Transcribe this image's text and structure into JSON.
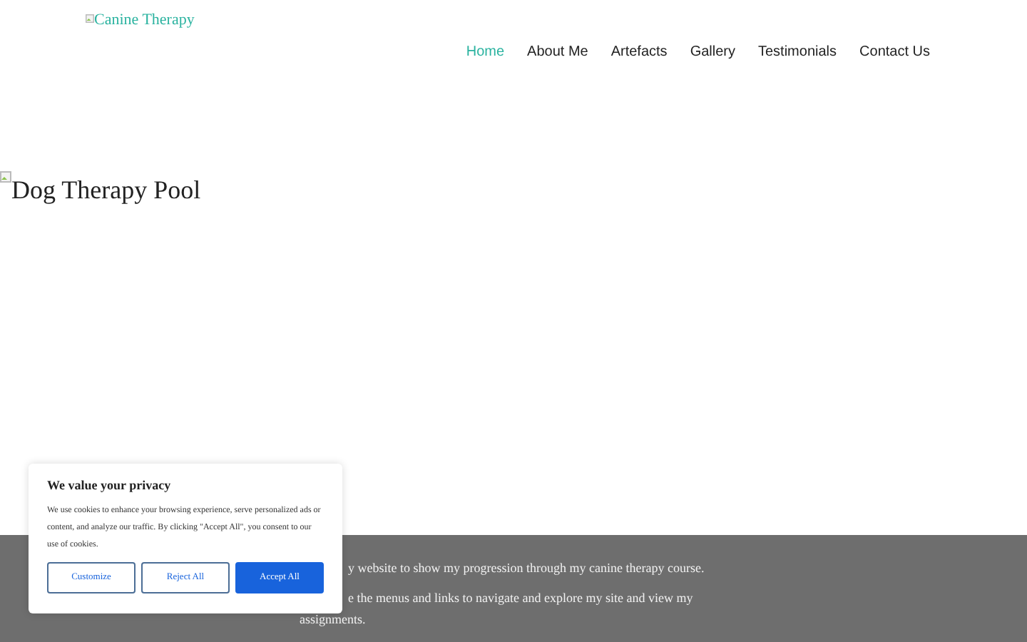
{
  "header": {
    "logo_alt": "Canine Therapy",
    "nav": [
      {
        "label": "Home",
        "selected": true
      },
      {
        "label": "About Me",
        "selected": false
      },
      {
        "label": "Artefacts",
        "selected": false
      },
      {
        "label": "Gallery",
        "selected": false
      },
      {
        "label": "Testimonials",
        "selected": false
      },
      {
        "label": "Contact Us",
        "selected": false
      }
    ]
  },
  "hero": {
    "image_alt": "Dog Therapy Pool"
  },
  "intro": {
    "paragraphs": [
      "y website to show my progression through my canine therapy course.",
      "e the menus and links to navigate and explore my site and view my assignments."
    ]
  },
  "cookie_banner": {
    "title": "We value your privacy",
    "text": "We use cookies to enhance your browsing experience, serve personalized ads or content, and analyze our traffic. By clicking \"Accept All\", you consent to our use of cookies.",
    "buttons": [
      {
        "label": "Customize",
        "kind": "outline"
      },
      {
        "label": "Reject All",
        "kind": "outline"
      },
      {
        "label": "Accept All",
        "kind": "primary"
      }
    ]
  }
}
